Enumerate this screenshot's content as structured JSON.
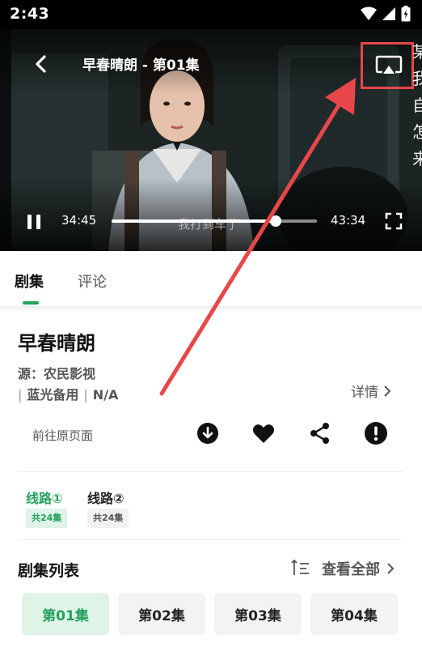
{
  "status_bar": {
    "time": "2:43"
  },
  "player": {
    "title": "早春晴朗 - 第01集",
    "current_time": "34:45",
    "total_time": "43:34",
    "progress": 0.798,
    "subtitle": "我打到车了",
    "danmaku": [
      "某",
      "我",
      "自",
      "怎",
      "来"
    ]
  },
  "tabs": [
    {
      "label": "剧集",
      "active": true
    },
    {
      "label": "评论",
      "active": false
    }
  ],
  "show": {
    "title": "早春晴朗",
    "source": "源：农民影视",
    "meta_items": [
      "蓝光备用",
      "N/A"
    ],
    "details_label": "详情",
    "origin_link": "前往原页面"
  },
  "action_icons": [
    "download-icon",
    "heart-icon",
    "share-icon",
    "alert-icon"
  ],
  "routes": [
    {
      "label": "线路①",
      "count": "共24集",
      "active": true
    },
    {
      "label": "线路②",
      "count": "共24集",
      "active": false
    }
  ],
  "episode_list": {
    "heading": "剧集列表",
    "view_all": "查看全部",
    "episodes": [
      "第01集",
      "第02集",
      "第03集",
      "第04集"
    ],
    "selected_index": 0
  },
  "colors": {
    "accent_green": "#23a05a",
    "highlight_red": "#e8474a"
  }
}
